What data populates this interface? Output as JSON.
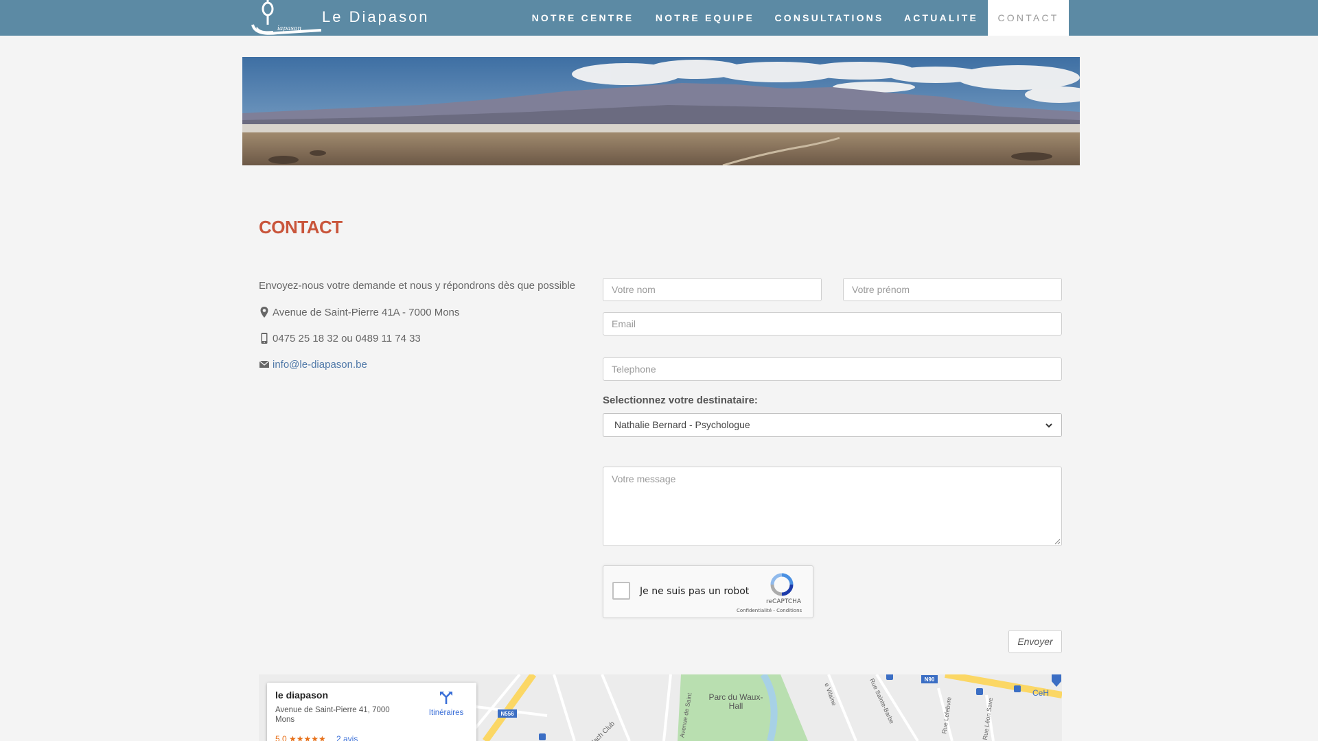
{
  "brand": {
    "name": "Le Diapason",
    "logo_text": "iapason"
  },
  "nav": {
    "items": [
      {
        "label": "NOTRE CENTRE"
      },
      {
        "label": "NOTRE EQUIPE"
      },
      {
        "label": "CONSULTATIONS"
      },
      {
        "label": "ACTUALITE"
      },
      {
        "label": "CONTACT",
        "active": true
      }
    ]
  },
  "page": {
    "title": "CONTACT"
  },
  "contact_info": {
    "intro": "Envoyez-nous votre demande et nous y répondrons dès que possible",
    "address": "Avenue de Saint-Pierre 41A - 7000 Mons",
    "phone": "0475 25 18 32 ou 0489 11 74 33",
    "email": "info@le-diapason.be"
  },
  "form": {
    "name_placeholder": "Votre nom",
    "firstname_placeholder": "Votre prénom",
    "email_placeholder": "Email",
    "phone_placeholder": "Telephone",
    "recipient_label": "Selectionnez votre destinataire:",
    "recipient_selected": "Nathalie Bernard - Psychologue",
    "message_placeholder": "Votre message",
    "send_label": "Envoyer"
  },
  "recaptcha": {
    "label": "Je ne suis pas un robot",
    "brand": "reCAPTCHA",
    "links": "Confidentialité - Conditions"
  },
  "map": {
    "place_name": "le diapason",
    "place_address": "Avenue de Saint-Pierre 41, 7000 Mons",
    "rating": "5,0 ★★★★★",
    "reviews": "2 avis",
    "directions_label": "Itinéraires",
    "labels": {
      "park": "Parc du Waux-Hall",
      "road_n56": "N556",
      "road_n90": "N90",
      "flach_club": "du Flach Club",
      "cee": "CeH"
    },
    "street_labels": [
      "Avenue de Saint",
      "e Vilaine",
      "Rue Sainte-Barbe",
      "Rue Lefebvre",
      "Rue Léon Save"
    ]
  },
  "colors": {
    "navbar": "#5c8aa4",
    "title": "#c9553b",
    "link": "#4f78a8"
  }
}
